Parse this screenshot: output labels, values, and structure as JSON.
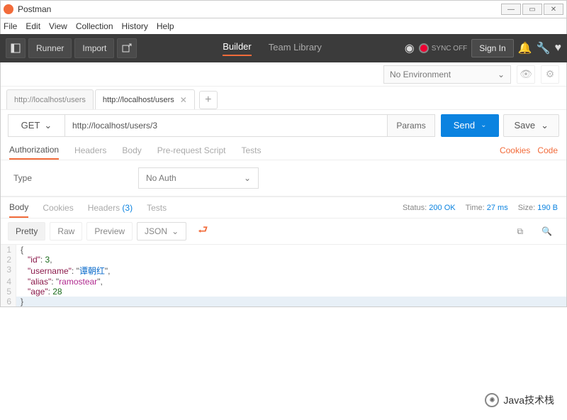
{
  "window": {
    "title": "Postman"
  },
  "menubar": [
    "File",
    "Edit",
    "View",
    "Collection",
    "History",
    "Help"
  ],
  "toolbar": {
    "runner": "Runner",
    "import": "Import",
    "tabs": {
      "builder": "Builder",
      "team": "Team Library"
    },
    "sync": "SYNC OFF",
    "signin": "Sign In"
  },
  "env": {
    "selected": "No Environment"
  },
  "request_tabs": [
    {
      "label": "http://localhost/users",
      "active": false
    },
    {
      "label": "http://localhost/users",
      "active": true
    }
  ],
  "request": {
    "method": "GET",
    "url": "http://localhost/users/3",
    "params": "Params",
    "send": "Send",
    "save": "Save",
    "subtabs": [
      "Authorization",
      "Headers",
      "Body",
      "Pre-request Script",
      "Tests"
    ],
    "right_links": {
      "cookies": "Cookies",
      "code": "Code"
    },
    "auth": {
      "label": "Type",
      "value": "No Auth"
    }
  },
  "response": {
    "tabs": {
      "body": "Body",
      "cookies": "Cookies",
      "headers": "Headers",
      "headers_count": "(3)",
      "tests": "Tests"
    },
    "status_label": "Status:",
    "status_value": "200 OK",
    "time_label": "Time:",
    "time_value": "27 ms",
    "size_label": "Size:",
    "size_value": "190 B",
    "viewer": {
      "pretty": "Pretty",
      "raw": "Raw",
      "preview": "Preview",
      "format": "JSON"
    },
    "json_body": {
      "id": 3,
      "username": "谭朝红",
      "alias": "ramostear",
      "age": 28
    }
  },
  "watermark": "Java技术栈"
}
